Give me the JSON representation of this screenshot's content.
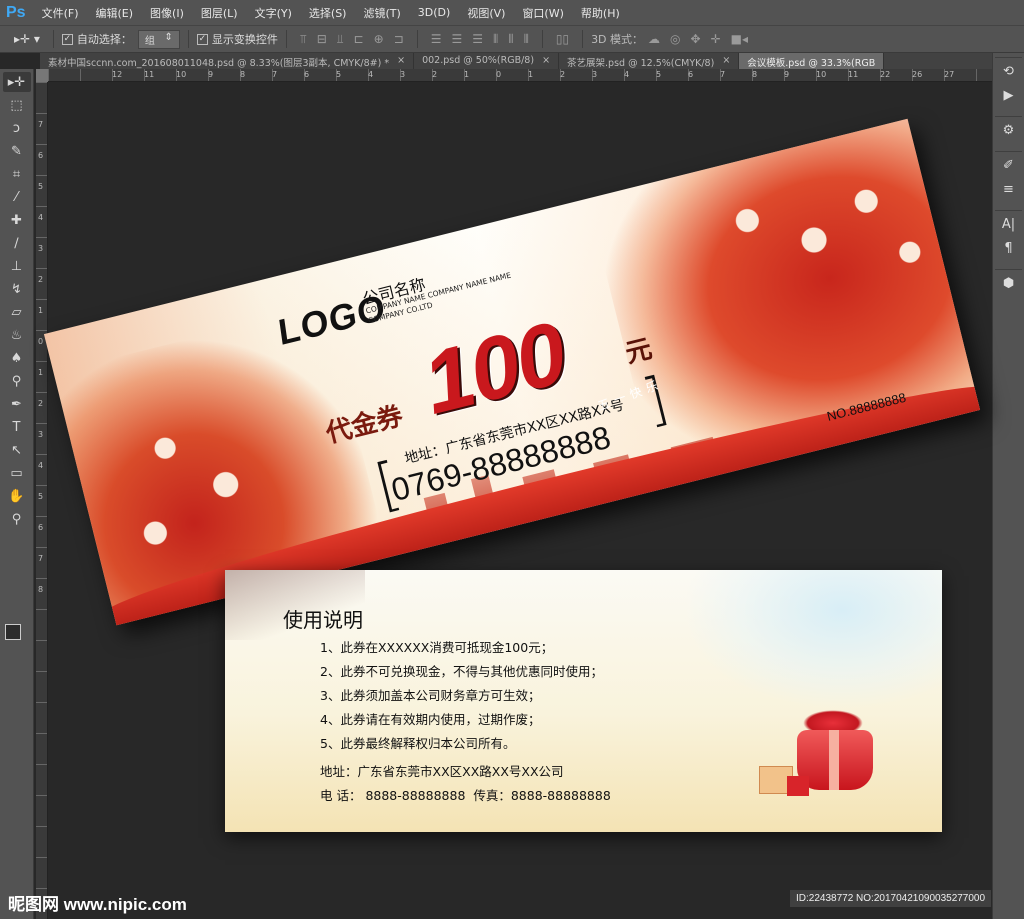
{
  "app": {
    "logo": "Ps"
  },
  "menu": [
    "文件(F)",
    "编辑(E)",
    "图像(I)",
    "图层(L)",
    "文字(Y)",
    "选择(S)",
    "滤镜(T)",
    "3D(D)",
    "视图(V)",
    "窗口(W)",
    "帮助(H)"
  ],
  "options": {
    "auto_select_label": "自动选择：",
    "auto_select_value": "组",
    "show_transform_label": "显示变换控件",
    "mode_3d_label": "3D 模式："
  },
  "tabs": [
    {
      "label": "素材中国sccnn.com_201608011048.psd @ 8.33%(图层3副本, CMYK/8#) *",
      "active": false
    },
    {
      "label": "002.psd @ 50%(RGB/8)",
      "active": false
    },
    {
      "label": "茶艺展架.psd @ 12.5%(CMYK/8)",
      "active": false
    },
    {
      "label": "会议模板.psd @ 33.3%(RGB",
      "active": true
    }
  ],
  "ruler_h": [
    "12",
    "11",
    "10",
    "9",
    "8",
    "7",
    "6",
    "5",
    "4",
    "3",
    "2",
    "1",
    "0",
    "1",
    "2",
    "3",
    "4",
    "5",
    "6",
    "7",
    "8",
    "9",
    "10",
    "11",
    "22",
    "26",
    "27"
  ],
  "ruler_v": [
    "7",
    "6",
    "5",
    "4",
    "3",
    "2",
    "1",
    "0",
    "1",
    "2",
    "3",
    "4",
    "5",
    "6",
    "7",
    "8"
  ],
  "coupon": {
    "logo": "LOGO",
    "company_name": "公司名称",
    "company_name_en": "COMPANY NAME COMPANY NAME NAME COMPANY CO.LTD",
    "voucher_type": "代金券",
    "amount": "100",
    "currency": "元",
    "address": "地址：广东省东莞市XX区XX路XX号",
    "phone": "0769-88888888",
    "holiday_banner": "五一快乐",
    "serial_no": "NO.88888888"
  },
  "instructions": {
    "title": "使用说明",
    "items": [
      "1、此券在XXXXXX消费可抵现金100元；",
      "2、此券不可兑换现金，不得与其他优惠同时使用；",
      "3、此券须加盖本公司财务章方可生效；",
      "4、此券请在有效期内使用，过期作废；",
      "5、此券最终解释权归本公司所有。"
    ],
    "address": "地址：广东省东莞市XX区XX路XX号XX公司",
    "contact": "电 话： 8888-88888888  传真：8888-88888888"
  },
  "watermark": {
    "site": "昵图网 www.nipic.com",
    "id": "ID:22438772 NO:20170421090035277000"
  }
}
